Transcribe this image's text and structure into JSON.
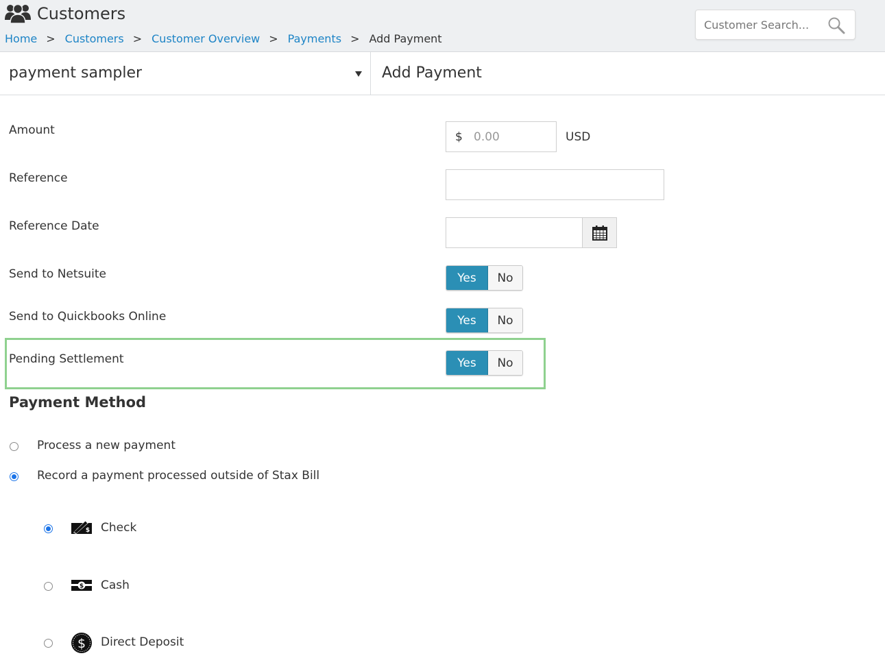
{
  "header": {
    "title": "Customers",
    "breadcrumb": {
      "home": "Home",
      "customers": "Customers",
      "customer_overview": "Customer Overview",
      "payments": "Payments",
      "current": "Add Payment",
      "separator": ">"
    },
    "search": {
      "placeholder": "Customer Search..."
    }
  },
  "customer_select": {
    "value": "payment sampler"
  },
  "page_title": "Add Payment",
  "form": {
    "amount": {
      "label": "Amount",
      "prefix": "$",
      "placeholder": "0.00",
      "currency": "USD"
    },
    "reference": {
      "label": "Reference",
      "value": ""
    },
    "reference_date": {
      "label": "Reference Date",
      "value": ""
    },
    "send_to_netsuite": {
      "label": "Send to Netsuite",
      "yes": "Yes",
      "no": "No",
      "selected": "Yes"
    },
    "send_to_quickbooks": {
      "label": "Send to Quickbooks Online",
      "yes": "Yes",
      "no": "No",
      "selected": "Yes"
    },
    "pending_settlement": {
      "label": "Pending Settlement",
      "yes": "Yes",
      "no": "No",
      "selected": "Yes"
    }
  },
  "payment_method": {
    "heading": "Payment Method",
    "options": [
      {
        "label": "Process a new payment",
        "checked": false
      },
      {
        "label": "Record a payment processed outside of Stax Bill",
        "checked": true
      }
    ],
    "sub_options": [
      {
        "label": "Check",
        "icon": "check-icon",
        "checked": true
      },
      {
        "label": "Cash",
        "icon": "cash-icon",
        "checked": false
      },
      {
        "label": "Direct Deposit",
        "icon": "dollar-coin-icon",
        "checked": false
      }
    ]
  },
  "colors": {
    "header_bg": "#eef0f2",
    "link": "#1d84c6",
    "toggle_active": "#2b8fb5",
    "highlight": "#8fd18f",
    "radio_checked": "#1a73e8"
  }
}
